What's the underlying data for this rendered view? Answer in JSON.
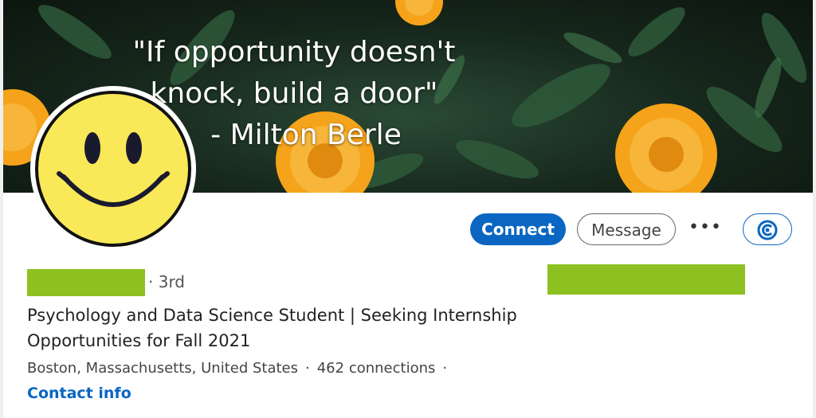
{
  "banner": {
    "quote_text": "\"If opportunity doesn't knock, build a door\"",
    "quote_author": "- Milton Berle"
  },
  "avatar": {
    "icon": "smiley-face-icon"
  },
  "actions": {
    "connect_label": "Connect",
    "message_label": "Message",
    "more_label": "•••",
    "company_icon": "company-logo-icon"
  },
  "profile": {
    "degree": "· 3rd",
    "headline": "Psychology and Data Science Student | Seeking Internship Opportunities for Fall 2021",
    "location": "Boston, Massachusetts, United States",
    "connections": "462 connections",
    "contact_info": "Contact info"
  },
  "colors": {
    "accent": "#0a66c2",
    "redaction": "#8dc021",
    "smiley_fill": "#f9e958",
    "flower": "#f5a31a"
  }
}
